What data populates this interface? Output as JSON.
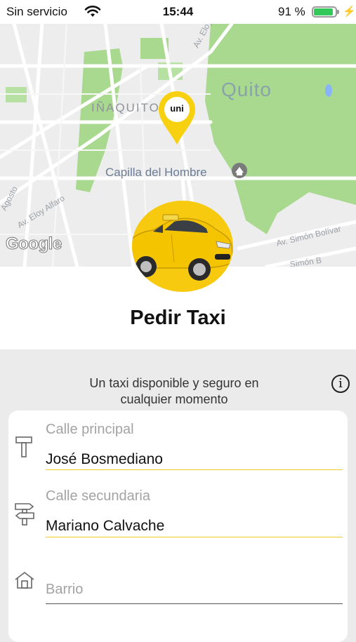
{
  "status_bar": {
    "carrier": "Sin servicio",
    "time": "15:44",
    "battery": "91 %",
    "battery_level": 0.91
  },
  "map": {
    "labels": {
      "city": "Quito",
      "district": "IÑAQUITO",
      "landmark": "Capilla del Hombre",
      "street_eloy_alfaro_top": "Av. Eloy Alfaro",
      "street_eloy_alfaro_left": "Av. Eloy Alfaro",
      "street_agosto": "Agosto",
      "street_simon_bolivar": "Av. Simón Bolívar",
      "street_simon_b2": "Simón B"
    },
    "attribution": "Google",
    "pin_logo": "uni"
  },
  "page": {
    "title": "Pedir Taxi",
    "tagline_line1": "Un taxi disponible y seguro en",
    "tagline_line2": "cualquier momento",
    "info_glyph": "i"
  },
  "form": {
    "fields": [
      {
        "label": "Calle principal",
        "value": "José Bosmediano",
        "icon": "signpost-single-icon"
      },
      {
        "label": "Calle secundaria",
        "value": "Mariano Calvache",
        "icon": "signpost-double-icon"
      },
      {
        "label": "",
        "value": "",
        "placeholder": "Barrio",
        "icon": "house-icon"
      }
    ]
  },
  "colors": {
    "accent_yellow": "#f7c90f",
    "underline_yellow": "#f2cc28",
    "park_green": "#a8d98f",
    "battery_green": "#34c759"
  }
}
